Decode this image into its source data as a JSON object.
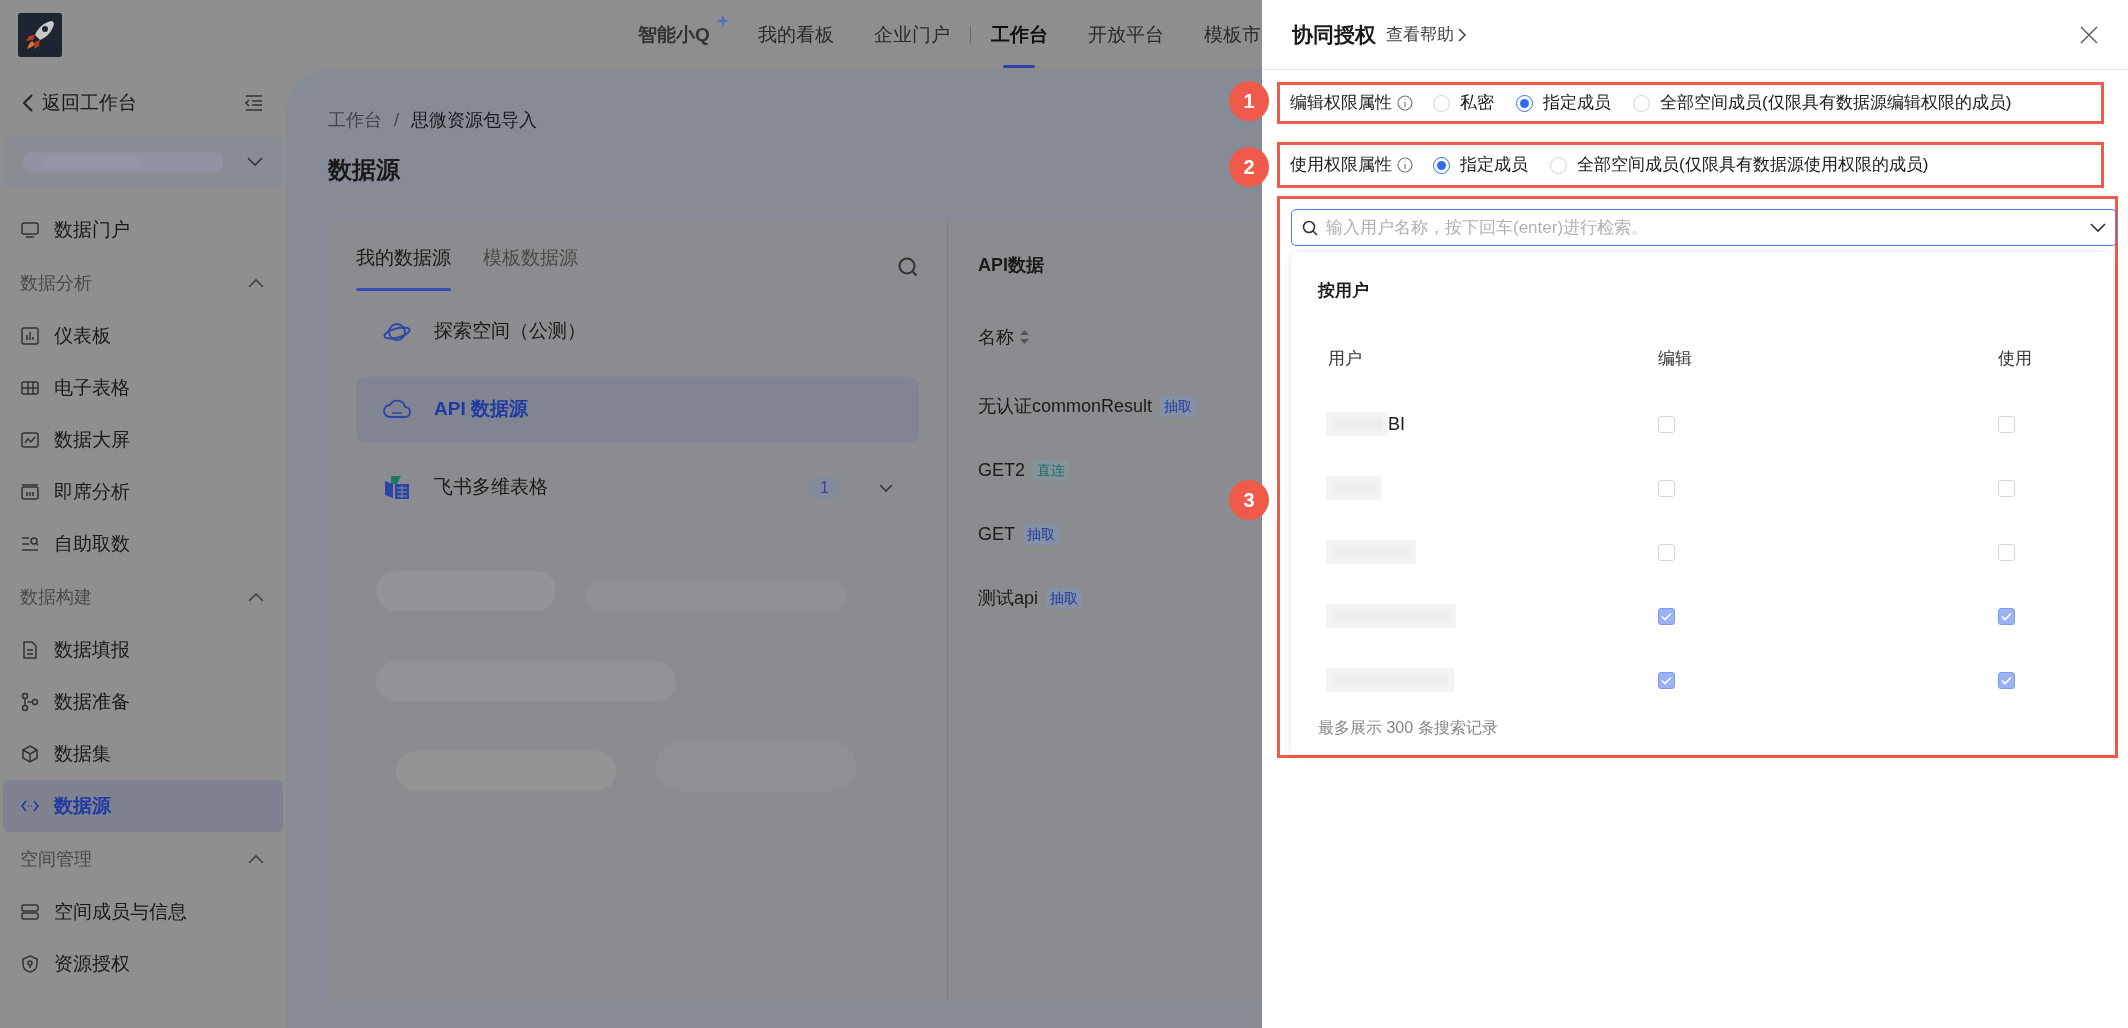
{
  "top_nav": {
    "items": [
      {
        "label": "智能小Q",
        "kind": "ai",
        "selected": false
      },
      {
        "label": "我的看板",
        "kind": "link",
        "selected": false
      },
      {
        "label": "企业门户",
        "kind": "link",
        "selected": false
      },
      {
        "label": "工作台",
        "kind": "link",
        "selected": true
      },
      {
        "label": "开放平台",
        "kind": "link",
        "selected": false
      },
      {
        "label": "模板市",
        "kind": "link",
        "selected": false
      }
    ]
  },
  "sidebar": {
    "back": "返回工作台",
    "items": [
      {
        "kind": "item",
        "label": "数据门户",
        "selected": false
      },
      {
        "kind": "group",
        "label": "数据分析",
        "expanded": true
      },
      {
        "kind": "item",
        "label": "仪表板",
        "selected": false
      },
      {
        "kind": "item",
        "label": "电子表格",
        "selected": false
      },
      {
        "kind": "item",
        "label": "数据大屏",
        "selected": false
      },
      {
        "kind": "item",
        "label": "即席分析",
        "selected": false
      },
      {
        "kind": "item",
        "label": "自助取数",
        "selected": false
      },
      {
        "kind": "group",
        "label": "数据构建",
        "expanded": true
      },
      {
        "kind": "item",
        "label": "数据填报",
        "selected": false
      },
      {
        "kind": "item",
        "label": "数据准备",
        "selected": false
      },
      {
        "kind": "item",
        "label": "数据集",
        "selected": false
      },
      {
        "kind": "item",
        "label": "数据源",
        "selected": true
      },
      {
        "kind": "group",
        "label": "空间管理",
        "expanded": true
      },
      {
        "kind": "item",
        "label": "空间成员与信息",
        "selected": false
      },
      {
        "kind": "item",
        "label": "资源授权",
        "selected": false
      }
    ]
  },
  "breadcrumb": [
    "工作台",
    "/",
    "思微资源包导入"
  ],
  "page_title": "数据源",
  "source_tabs": [
    {
      "label": "我的数据源",
      "selected": true
    },
    {
      "label": "模板数据源",
      "selected": false
    }
  ],
  "sources": [
    {
      "label": "探索空间（公测）",
      "selected": false
    },
    {
      "label": "API 数据源",
      "selected": true
    },
    {
      "label": "飞书多维表格",
      "selected": false,
      "count": "1"
    }
  ],
  "api_panel": {
    "title": "API数据",
    "columns": [
      "名称"
    ],
    "rows": [
      {
        "name": "无认证commonResult",
        "tag": "抽取",
        "kind": "extract"
      },
      {
        "name": "GET2",
        "tag": "直连",
        "kind": "direct"
      },
      {
        "name": "GET",
        "tag": "抽取",
        "kind": "extract"
      },
      {
        "name": "测试api",
        "tag": "抽取",
        "kind": "extract"
      }
    ]
  },
  "drawer": {
    "title": "协同授权",
    "help": "查看帮助",
    "edit_permission": {
      "label": "编辑权限属性",
      "options": [
        {
          "label": "私密",
          "selected": false
        },
        {
          "label": "指定成员",
          "selected": true
        },
        {
          "label": "全部空间成员(仅限具有数据源编辑权限的成员)",
          "selected": false
        }
      ]
    },
    "use_permission": {
      "label": "使用权限属性",
      "options": [
        {
          "label": "指定成员",
          "selected": true
        },
        {
          "label": "全部空间成员(仅限具有数据源使用权限的成员)",
          "selected": false
        }
      ]
    },
    "search": {
      "placeholder": "输入用户名称，按下回车(enter)进行检索。"
    },
    "section_title": "按用户",
    "columns": [
      "用户",
      "编辑",
      "使用"
    ],
    "users": [
      {
        "name": "BI",
        "edit": false,
        "use": false
      },
      {
        "edit": false,
        "use": false
      },
      {
        "edit": false,
        "use": false
      },
      {
        "edit": true,
        "use": true
      },
      {
        "edit": true,
        "use": true
      }
    ],
    "footer": "最多展示 300 条搜索记录",
    "callouts": [
      "1",
      "2",
      "3"
    ]
  }
}
